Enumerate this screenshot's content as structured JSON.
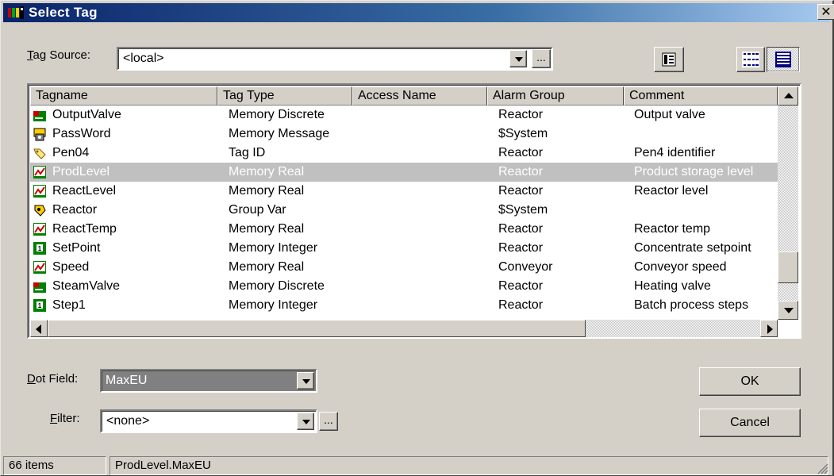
{
  "window": {
    "title": "Select Tag",
    "close_glyph": "✕"
  },
  "tag_source": {
    "label_pre": "",
    "label_key": "T",
    "label_post": "ag Source:",
    "value": "<local>",
    "browse": "..."
  },
  "toolbar": {
    "icons": [
      "properties-icon",
      "details-view-icon",
      "list-view-icon"
    ]
  },
  "columns": [
    "Tagname",
    "Tag Type",
    "Access Name",
    "Alarm Group",
    "Comment"
  ],
  "rows": [
    {
      "icon": "memory-discrete-icon",
      "name": "OutputValve",
      "type": "Memory Discrete",
      "access": "",
      "group": "Reactor",
      "comment": "Output valve",
      "selected": false
    },
    {
      "icon": "memory-message-icon",
      "name": "PassWord",
      "type": "Memory Message",
      "access": "",
      "group": "$System",
      "comment": "",
      "selected": false
    },
    {
      "icon": "tag-id-icon",
      "name": "Pen04",
      "type": "Tag ID",
      "access": "",
      "group": "Reactor",
      "comment": "Pen4 identifier",
      "selected": false
    },
    {
      "icon": "memory-real-icon",
      "name": "ProdLevel",
      "type": "Memory Real",
      "access": "",
      "group": "Reactor",
      "comment": "Product storage level",
      "selected": true
    },
    {
      "icon": "memory-real-icon",
      "name": "ReactLevel",
      "type": "Memory Real",
      "access": "",
      "group": "Reactor",
      "comment": "Reactor level",
      "selected": false
    },
    {
      "icon": "group-var-icon",
      "name": "Reactor",
      "type": "Group Var",
      "access": "",
      "group": "$System",
      "comment": "",
      "selected": false
    },
    {
      "icon": "memory-real-icon",
      "name": "ReactTemp",
      "type": "Memory Real",
      "access": "",
      "group": "Reactor",
      "comment": "Reactor temp",
      "selected": false
    },
    {
      "icon": "memory-integer-icon",
      "name": "SetPoint",
      "type": "Memory Integer",
      "access": "",
      "group": "Reactor",
      "comment": "Concentrate setpoint",
      "selected": false
    },
    {
      "icon": "memory-real-icon",
      "name": "Speed",
      "type": "Memory Real",
      "access": "",
      "group": "Conveyor",
      "comment": "Conveyor speed",
      "selected": false
    },
    {
      "icon": "memory-discrete-icon",
      "name": "SteamValve",
      "type": "Memory Discrete",
      "access": "",
      "group": "Reactor",
      "comment": "Heating valve",
      "selected": false
    },
    {
      "icon": "memory-integer-icon",
      "name": "Step1",
      "type": "Memory Integer",
      "access": "",
      "group": "Reactor",
      "comment": "Batch process steps",
      "selected": false
    }
  ],
  "dot_field": {
    "label_key": "D",
    "label_post": "ot Field:",
    "value": "MaxEU"
  },
  "filter": {
    "label_key": "F",
    "label_post": "ilter:",
    "value": "<none>",
    "browse": "..."
  },
  "buttons": {
    "ok": "OK",
    "cancel": "Cancel"
  },
  "status": {
    "count": "66 items",
    "selection": "ProdLevel.MaxEU"
  },
  "colors": {
    "title_start": "#0a246a",
    "title_end": "#a6caf0",
    "face": "#d4d0c8",
    "selected_row": "#c0c0c0",
    "dotfield_bg": "#808080"
  }
}
